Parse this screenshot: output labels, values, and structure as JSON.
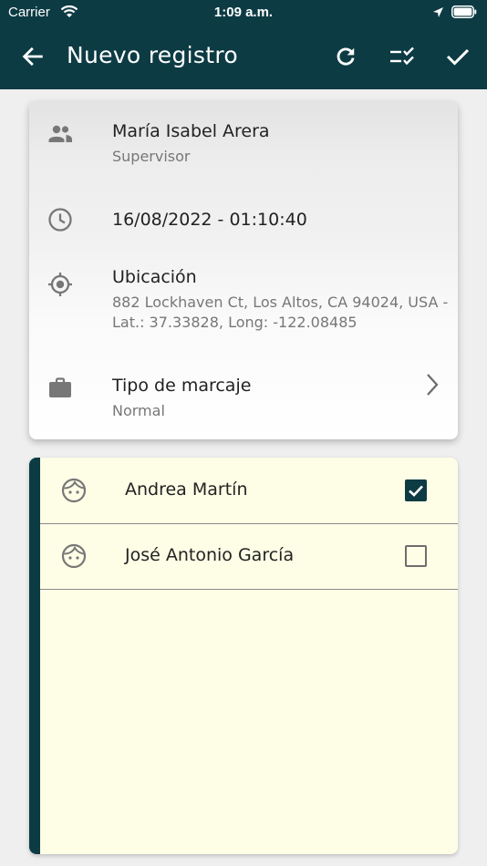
{
  "status_bar": {
    "carrier": "Carrier",
    "time": "1:09 a.m."
  },
  "header": {
    "title": "Nuevo registro"
  },
  "info": {
    "user_name": "María Isabel Arera",
    "user_role": "Supervisor",
    "datetime": "16/08/2022 - 01:10:40",
    "location_label": "Ubicación",
    "location_address": "882 Lockhaven Ct, Los Altos, CA 94024, USA -",
    "location_coords": "Lat.: 37.33828, Long: -122.08485",
    "mark_type_label": "Tipo de marcaje",
    "mark_type_value": "Normal"
  },
  "people": [
    {
      "name": "Andrea Martín",
      "checked": true
    },
    {
      "name": "José Antonio García",
      "checked": false
    }
  ],
  "colors": {
    "primary": "#0d3b44",
    "list_background": "#fefde6",
    "page_background": "#efefef"
  }
}
